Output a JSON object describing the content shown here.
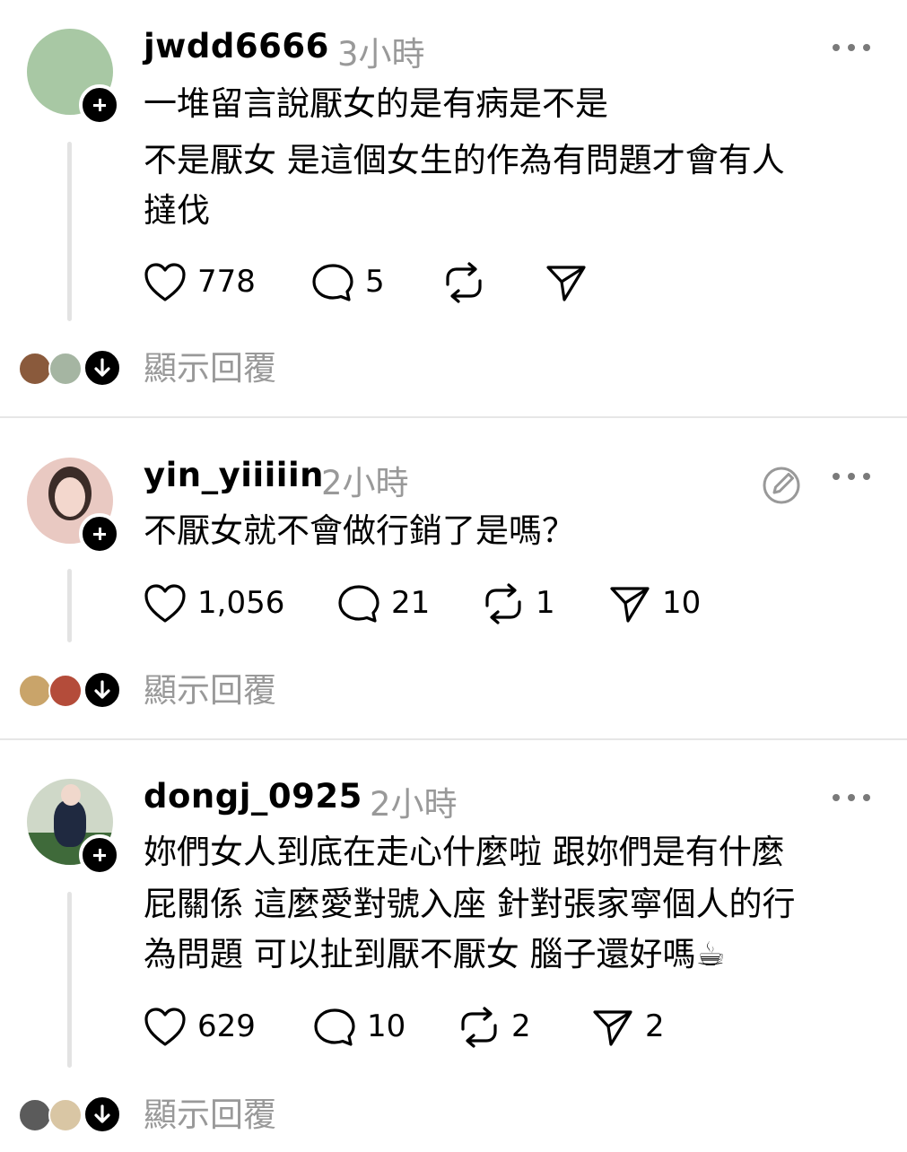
{
  "posts": [
    {
      "username": "jwdd6666",
      "time": "3小時",
      "lines": [
        "一堆留言說厭女的是有病是不是",
        "不是厭女 是這個女生的作為有問題才會有人",
        "撻伐"
      ],
      "likes": "778",
      "comments": "5",
      "reposts": "",
      "shares": "",
      "show_replies": "顯示回覆"
    },
    {
      "username": "yin_yiiiiin",
      "time": "2小時",
      "lines": [
        "不厭女就不會做行銷了是嗎？"
      ],
      "likes": "1,056",
      "comments": "21",
      "reposts": "1",
      "shares": "10",
      "show_replies": "顯示回覆"
    },
    {
      "username": "dongj_0925",
      "time": "2小時",
      "lines": [
        "妳們女人到底在走心什麼啦 跟妳們是有什麼",
        "屁關係 這麼愛對號入座 針對張家寧個人的行",
        "為問題 可以扯到厭不厭女 腦子還好嗎☕"
      ],
      "likes": "629",
      "comments": "10",
      "reposts": "2",
      "shares": "2",
      "show_replies": "顯示回覆"
    }
  ],
  "icons": {
    "like": "heart-icon",
    "comment": "comment-bubble-icon",
    "repost": "repost-icon",
    "share": "send-icon",
    "more": "more-dots-icon",
    "follow": "plus-icon",
    "expand": "arrow-down-icon",
    "edit": "edit-icon"
  }
}
